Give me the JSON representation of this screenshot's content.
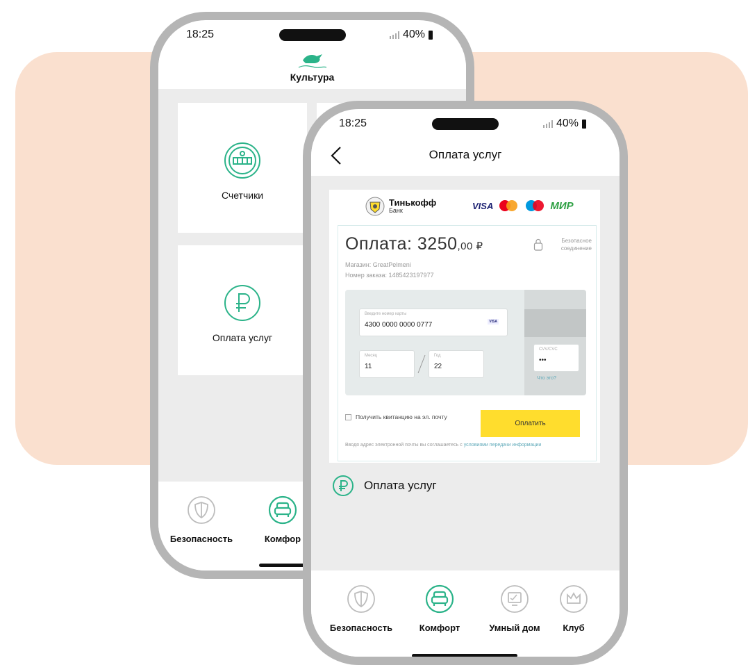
{
  "colors": {
    "accent": "#2bb389",
    "peach": "#fae0cf",
    "pay_button": "#ffdd2d",
    "inactive_icon": "#bdbdbd"
  },
  "back_phone": {
    "status": {
      "time": "18:25",
      "battery": "40%"
    },
    "header_title": "Культура",
    "tiles": [
      {
        "label": "Счетчики",
        "icon": "meter-icon"
      },
      {
        "label": "Оплата услуг",
        "icon": "ruble-icon"
      }
    ],
    "nav": [
      {
        "label": "Безопасность",
        "icon": "shield-icon"
      },
      {
        "label": "Комфор",
        "icon": "armchair-icon"
      }
    ]
  },
  "front_phone": {
    "status": {
      "time": "18:25",
      "battery": "40%"
    },
    "header_title": "Оплата услуг",
    "payment": {
      "bank_name": "Тинькофф",
      "bank_sub": "Банк",
      "logos": {
        "visa": "VISA",
        "mir": "МИР"
      },
      "amount_label": "Оплата: 3250",
      "amount_cents": ",00 ₽",
      "secure_line1": "Безопасное",
      "secure_line2": "соединение",
      "shop": "Магазин: GreatPelmeni",
      "order": "Номер заказа: 1485423197977",
      "card_label": "Введите номер карты",
      "card_number": "4300 0000 0000 0777",
      "card_brand": "VISA",
      "month_label": "Месяц",
      "month": "11",
      "year_label": "Год",
      "year": "22",
      "cvv_label": "CVV/CVC",
      "cvv": "•••",
      "what_is": "Что это?",
      "receipt_checkbox": "Получить квитанцию на эл. почту",
      "pay_button": "Оплатить",
      "agreement_text": "Вводя адрес электронной почты вы соглашаетесь с ",
      "agreement_link": "условиями передачи информации"
    },
    "service_row": "Оплата услуг",
    "nav": [
      {
        "label": "Безопасность",
        "icon": "shield-icon"
      },
      {
        "label": "Комфорт",
        "icon": "armchair-icon"
      },
      {
        "label": "Умный дом",
        "icon": "monitor-icon"
      },
      {
        "label": "Клуб",
        "icon": "crown-icon"
      }
    ]
  }
}
